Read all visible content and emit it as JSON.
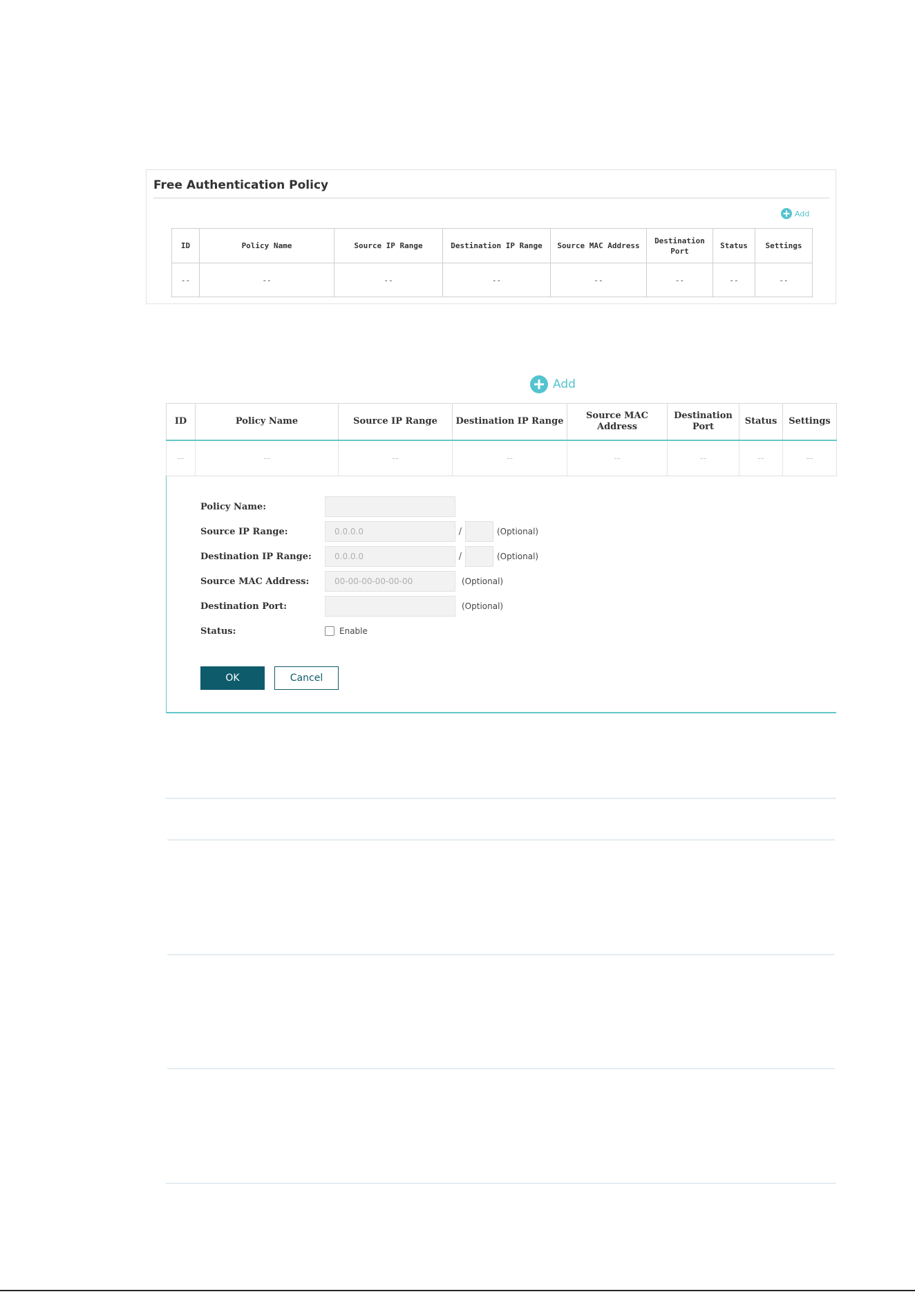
{
  "panel1": {
    "title": "Free Authentication Policy",
    "add_label": "Add",
    "columns": [
      "ID",
      "Policy Name",
      "Source IP Range",
      "Destination IP Range",
      "Source MAC Address",
      "Destination Port",
      "Status",
      "Settings"
    ],
    "row": [
      "--",
      "--",
      "--",
      "--",
      "--",
      "--",
      "--",
      "--"
    ]
  },
  "panel2": {
    "add_label": "Add",
    "columns": [
      "ID",
      "Policy Name",
      "Source IP Range",
      "Destination IP Range",
      "Source MAC Address",
      "Destination Port",
      "Status",
      "Settings"
    ],
    "row": [
      "--",
      "--",
      "--",
      "--",
      "--",
      "--",
      "--",
      "--"
    ],
    "form": {
      "policy_name_label": "Policy Name:",
      "policy_name_value": "",
      "source_ip_label": "Source IP Range:",
      "source_ip_placeholder": "0.0.0.0",
      "dest_ip_label": "Destination IP Range:",
      "dest_ip_placeholder": "0.0.0.0",
      "source_mac_label": "Source MAC Address:",
      "source_mac_placeholder": "00-00-00-00-00-00",
      "dest_port_label": "Destination Port:",
      "dest_port_value": "",
      "status_label": "Status:",
      "enable_label": "Enable",
      "enable_checked": false,
      "slash": "/",
      "optional": "(Optional)",
      "ok_label": "OK",
      "cancel_label": "Cancel"
    }
  },
  "colors": {
    "accent": "#53c4cf",
    "primary_button": "#0e5b6c",
    "form_border": "#63c7c8"
  }
}
